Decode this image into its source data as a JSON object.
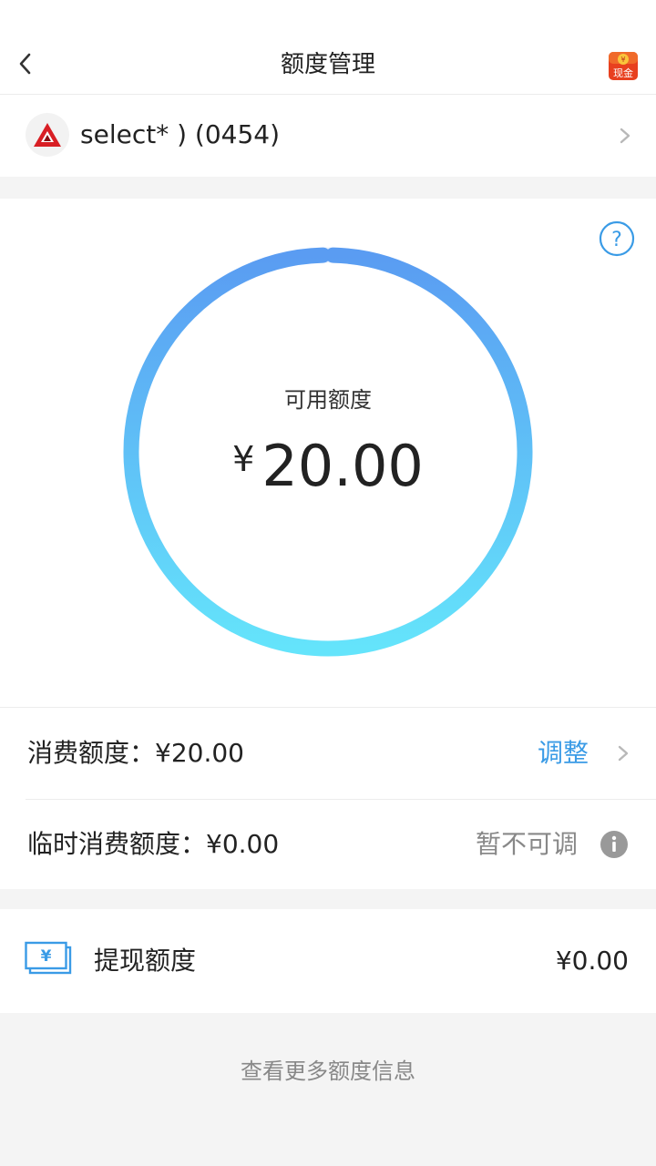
{
  "header": {
    "title": "额度管理",
    "cash_badge": "现金"
  },
  "card": {
    "name": "select* ) (0454)"
  },
  "available": {
    "label": "可用额度",
    "currency": "¥",
    "amount": "20.00"
  },
  "quotas": {
    "consume_label": "消费额度：",
    "consume_value": "¥20.00",
    "adjust_label": "调整",
    "temp_label": "临时消费额度：",
    "temp_value": "¥0.00",
    "temp_status": "暂不可调"
  },
  "withdraw": {
    "label": "提现额度",
    "value": "¥0.00"
  },
  "footer": {
    "more_label": "查看更多额度信息"
  },
  "colors": {
    "accent": "#3a9be6",
    "ring_top": "#5a9cf2",
    "ring_bottom": "#64e4fb",
    "bank_red": "#d81e24"
  },
  "icons": {
    "back": "chevron-left-icon",
    "cash": "cash-badge-icon",
    "help": "question-circle-icon",
    "info": "info-icon",
    "withdraw": "yuan-note-icon"
  }
}
